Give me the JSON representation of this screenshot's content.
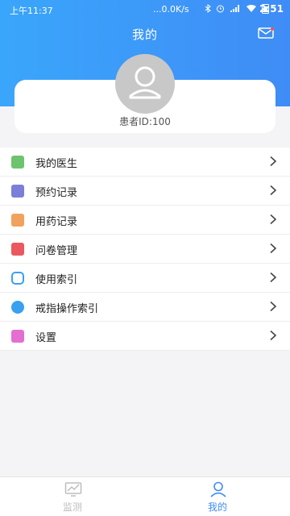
{
  "status_bar": {
    "time": "上午11:37",
    "network": "...0.0K/s",
    "clock": "2:51"
  },
  "header": {
    "title": "我的"
  },
  "profile": {
    "patient_id": "患者ID:100"
  },
  "menu": {
    "items": [
      {
        "label": "我的医生",
        "icon": "doctor-icon",
        "color": "#6dc36e"
      },
      {
        "label": "预约记录",
        "icon": "appointment-icon",
        "color": "#7b7fd8"
      },
      {
        "label": "用药记录",
        "icon": "medication-icon",
        "color": "#f1a25c"
      },
      {
        "label": "问卷管理",
        "icon": "questionnaire-icon",
        "color": "#e9595f"
      },
      {
        "label": "使用索引",
        "icon": "index-icon",
        "color": "#3aa0f0"
      },
      {
        "label": "戒指操作索引",
        "icon": "ring-icon",
        "color": "#3aa0f0"
      },
      {
        "label": "设置",
        "icon": "settings-icon",
        "color": "#e36fd1"
      }
    ]
  },
  "tabbar": {
    "tabs": [
      {
        "label": "监测",
        "icon": "monitor-icon",
        "active": false
      },
      {
        "label": "我的",
        "icon": "profile-icon",
        "active": true
      }
    ]
  },
  "colors": {
    "accent": "#3f8cf6",
    "inactive": "#bdbdbd"
  }
}
